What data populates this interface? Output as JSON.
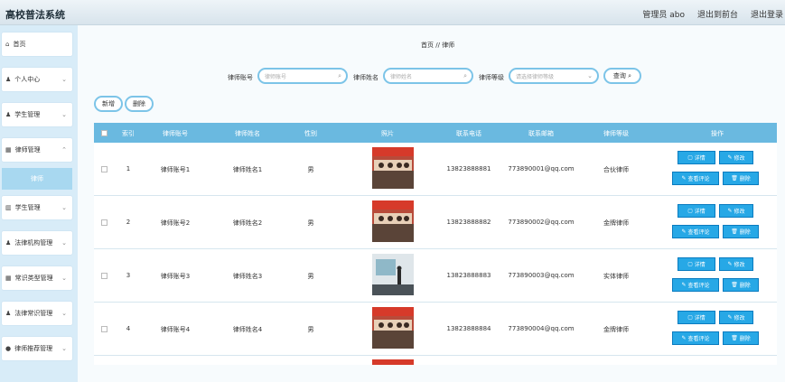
{
  "header": {
    "window_caption": "",
    "app_title": "高校普法系统",
    "user_label": "管理员 abo",
    "exit_front": "退出到前台",
    "logout": "退出登录"
  },
  "sidebar": {
    "items": [
      {
        "label": "首页",
        "icon": "home-icon"
      },
      {
        "label": "个人中心",
        "icon": "user-icon"
      },
      {
        "label": "学生管理",
        "icon": "user-icon"
      },
      {
        "label": "律师管理",
        "icon": "grid-icon"
      },
      {
        "label": "学生管理",
        "icon": "chart-icon"
      },
      {
        "label": "法律机构管理",
        "icon": "user-icon"
      },
      {
        "label": "常识类型管理",
        "icon": "grid-icon"
      },
      {
        "label": "法律常识管理",
        "icon": "user-icon"
      },
      {
        "label": "律师推荐管理",
        "icon": "chat-icon"
      }
    ],
    "active_sub": "律师"
  },
  "breadcrumb": {
    "home": "首页",
    "sep": "//",
    "current": "律师"
  },
  "search": {
    "field1_label": "律师账号",
    "field1_placeholder": "律师账号",
    "field2_label": "律师姓名",
    "field2_placeholder": "律师姓名",
    "field3_label": "律师等级",
    "field3_placeholder": "请选择律师等级",
    "query_button": "查询"
  },
  "actions": {
    "add": "新增",
    "delete": "删除"
  },
  "table": {
    "headers": [
      "索引",
      "律师账号",
      "律师姓名",
      "性别",
      "照片",
      "联系电话",
      "联系邮箱",
      "律师等级",
      "操作"
    ],
    "rows": [
      {
        "index": "1",
        "account": "律师账号1",
        "name": "律师姓名1",
        "gender": "男",
        "phone": "13823888881",
        "email": "773890001@qq.com",
        "level": "合伙律师"
      },
      {
        "index": "2",
        "account": "律师账号2",
        "name": "律师姓名2",
        "gender": "男",
        "phone": "13823888882",
        "email": "773890002@qq.com",
        "level": "金牌律师"
      },
      {
        "index": "3",
        "account": "律师账号3",
        "name": "律师姓名3",
        "gender": "男",
        "phone": "13823888883",
        "email": "773890003@qq.com",
        "level": "实体律师"
      },
      {
        "index": "4",
        "account": "律师账号4",
        "name": "律师姓名4",
        "gender": "男",
        "phone": "13823888884",
        "email": "773890004@qq.com",
        "level": "金牌律师"
      }
    ],
    "op_labels": {
      "detail": "详情",
      "edit": "修改",
      "comments": "查看评论",
      "remove": "删除"
    }
  },
  "colors": {
    "accent": "#6ab9e0",
    "op_button": "#27a8e6",
    "sidebar_bg": "#d8ecf8"
  }
}
